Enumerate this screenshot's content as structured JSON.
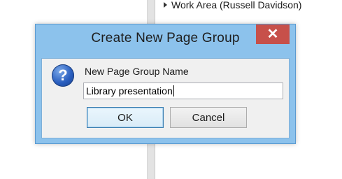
{
  "background": {
    "tree_item_label": "Work Area (Russell Davidson)"
  },
  "dialog": {
    "title": "Create New Page Group",
    "close_glyph": "✕",
    "field_label": "New Page Group Name",
    "input_value": "Library presentation",
    "ok_label": "OK",
    "cancel_label": "Cancel",
    "icon": "question-icon",
    "colors": {
      "title_bar": "#8cc2ec",
      "close_button": "#c7504a",
      "client_area": "#f0f0f0"
    }
  }
}
